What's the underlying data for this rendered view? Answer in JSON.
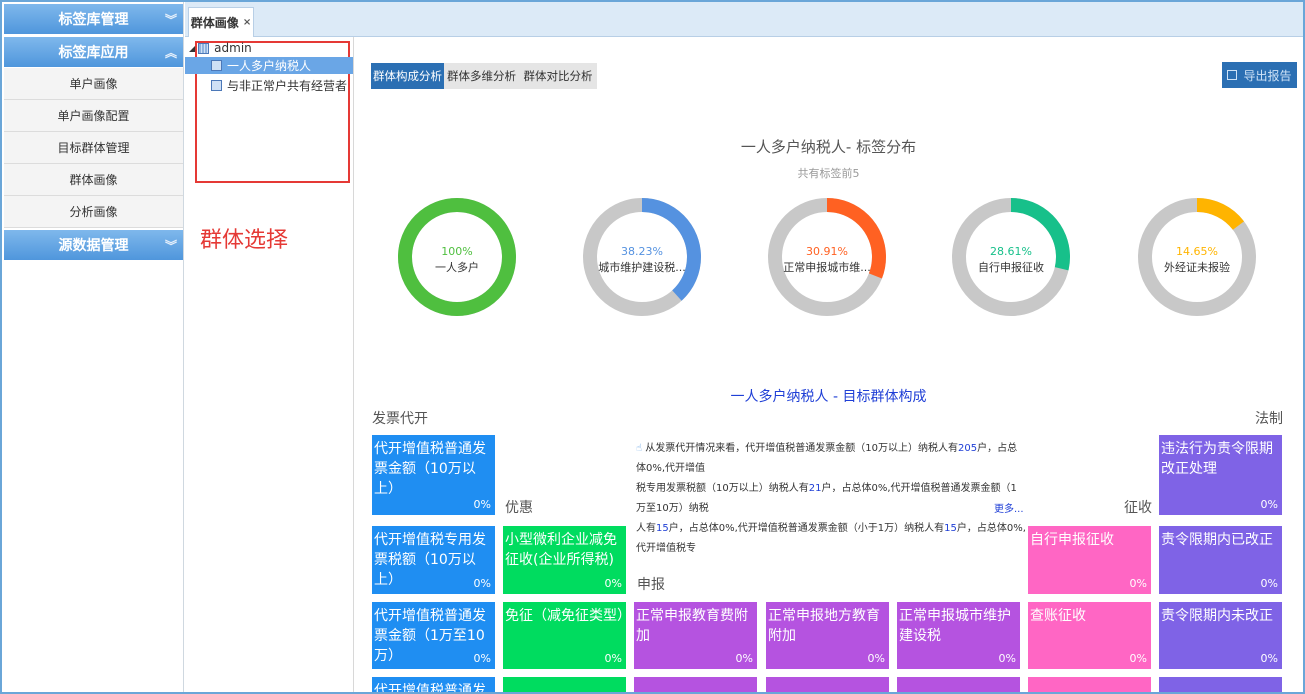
{
  "sidebar": {
    "sections": [
      {
        "label": "标签库管理",
        "chevron": "double-down",
        "items": []
      },
      {
        "label": "标签库应用",
        "chevron": "double-up",
        "items": [
          "单户画像",
          "单户画像配置",
          "目标群体管理",
          "群体画像",
          "分析画像"
        ]
      },
      {
        "label": "源数据管理",
        "chevron": "double-down",
        "items": []
      }
    ]
  },
  "tabs": [
    {
      "label": "群体画像",
      "close": "×"
    }
  ],
  "tree": {
    "root": "admin",
    "nodes": [
      "一人多户纳税人",
      "与非正常户共有经营者"
    ],
    "annotation": "群体选择"
  },
  "main": {
    "subtabs": [
      "群体构成分析",
      "群体多维分析",
      "群体对比分析"
    ],
    "export_label": "导出报告",
    "donut_title": "一人多户纳税人- 标签分布",
    "donut_subtitle": "共有标签前5",
    "donuts": [
      {
        "pct": "100%",
        "label": "一人多户",
        "value": 100,
        "color": "#4fbf3f"
      },
      {
        "pct": "38.23%",
        "label": "城市维护建设税...",
        "value": 38.23,
        "color": "#5592e0"
      },
      {
        "pct": "30.91%",
        "label": "正常申报城市维...",
        "value": 30.91,
        "color": "#ff6122"
      },
      {
        "pct": "28.61%",
        "label": "自行申报征收",
        "value": 28.61,
        "color": "#17c08a"
      },
      {
        "pct": "14.65%",
        "label": "外经证未报验",
        "value": 14.65,
        "color": "#ffb400"
      }
    ],
    "section_title": "一人多户纳税人 - 目标群体构成",
    "group_labels": {
      "fapiao": "发票代开",
      "youhui": "优惠",
      "shenbao": "申报",
      "zhengshou": "征收",
      "fazhi": "法制"
    },
    "info": {
      "line1_a": "从发票代开情况来看，代开增值税普通发票金额（10万以上）纳税人有",
      "line1_num": "205",
      "line1_b": "户，占总体0%,代开增值",
      "line2_a": "税专用发票税额（10万以上）纳税人有",
      "line2_num": "21",
      "line2_b": "户，占总体0%,代开增值税普通发票金额（1万至10万）纳税",
      "line3_a": "人有",
      "line3_num1": "15",
      "line3_b": "户，占总体0%,代开增值税普通发票金额（小于1万）纳税人有",
      "line3_num2": "15",
      "line3_c": "户，占总体0%,代开增值税专",
      "more": "更多..."
    },
    "tiles": {
      "blue1": "代开增值税普通发票金额（10万以上）",
      "blue2": "代开增值税专用发票税额（10万以上）",
      "blue3": "代开增值税普通发票金额（1万至10万）",
      "blue4": "代开增值税普通发票金",
      "green1": "小型微利企业减免征收(企业所得税)",
      "green2": "免征（减免征类型）",
      "purple1": "正常申报教育费附加",
      "purple2": "正常申报地方教育附加",
      "purple3": "正常申报城市维护建设税",
      "pink1": "自行申报征收",
      "pink2": "查账征收",
      "violet1": "违法行为责令限期改正处理",
      "violet2": "责令限期内已改正",
      "violet3": "责令限期内未改正",
      "pct": "0%"
    }
  }
}
